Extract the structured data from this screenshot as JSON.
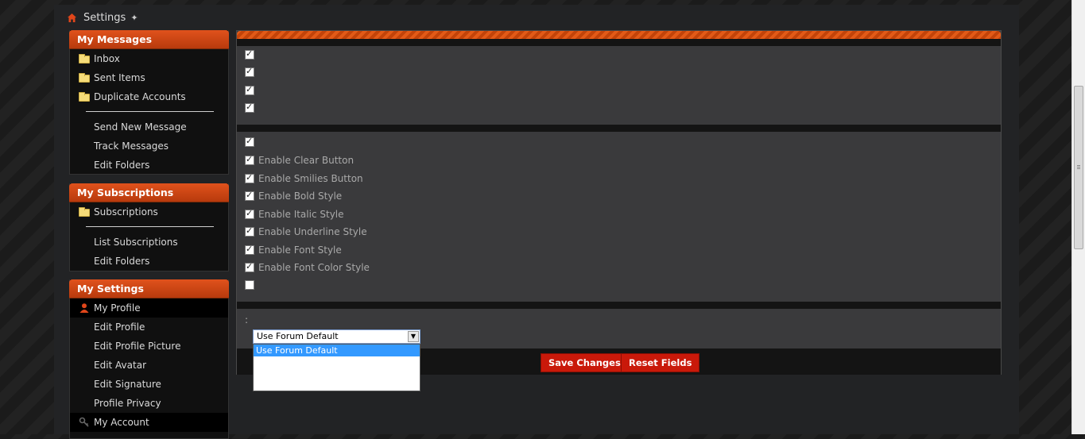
{
  "breadcrumb": {
    "label": "Settings",
    "sep": "✦"
  },
  "sidebar": {
    "messages": {
      "title": "My Messages",
      "folders": [
        "Inbox",
        "Sent Items",
        "Duplicate Accounts"
      ],
      "links": [
        "Send New Message",
        "Track Messages",
        "Edit Folders"
      ]
    },
    "subscriptions": {
      "title": "My Subscriptions",
      "folders": [
        "Subscriptions"
      ],
      "links": [
        "List Subscriptions",
        "Edit Folders"
      ]
    },
    "settings": {
      "title": "My Settings",
      "profile": "My Profile",
      "links": [
        "Edit Profile",
        "Edit Profile Picture",
        "Edit Avatar",
        "Edit Signature",
        "Profile Privacy"
      ],
      "account": "My Account"
    }
  },
  "main": {
    "group1": [
      {
        "label": "",
        "checked": true
      },
      {
        "label": "",
        "checked": true
      },
      {
        "label": "",
        "checked": true
      },
      {
        "label": "",
        "checked": true
      }
    ],
    "group2": [
      {
        "label": "",
        "checked": true
      },
      {
        "label": "Enable Clear Button",
        "checked": true
      },
      {
        "label": "Enable Smilies Button",
        "checked": true
      },
      {
        "label": "Enable Bold Style",
        "checked": true
      },
      {
        "label": "Enable Italic Style",
        "checked": true
      },
      {
        "label": "Enable Underline Style",
        "checked": true
      },
      {
        "label": "Enable Font Style",
        "checked": true
      },
      {
        "label": "Enable Font Color Style",
        "checked": true
      },
      {
        "label": "",
        "checked": false
      }
    ],
    "select_label": ":",
    "select_value": "Use Forum Default",
    "select_options": [
      "Use Forum Default"
    ],
    "save_label": "Save Changes",
    "reset_label": "Reset Fields"
  },
  "colors": {
    "accent": "#e0521c",
    "button": "#c9190a",
    "panel": "#3a3a3c"
  },
  "icons": [
    "home-icon",
    "folder-icon",
    "user-icon",
    "key-icon",
    "chevron-down-icon"
  ]
}
